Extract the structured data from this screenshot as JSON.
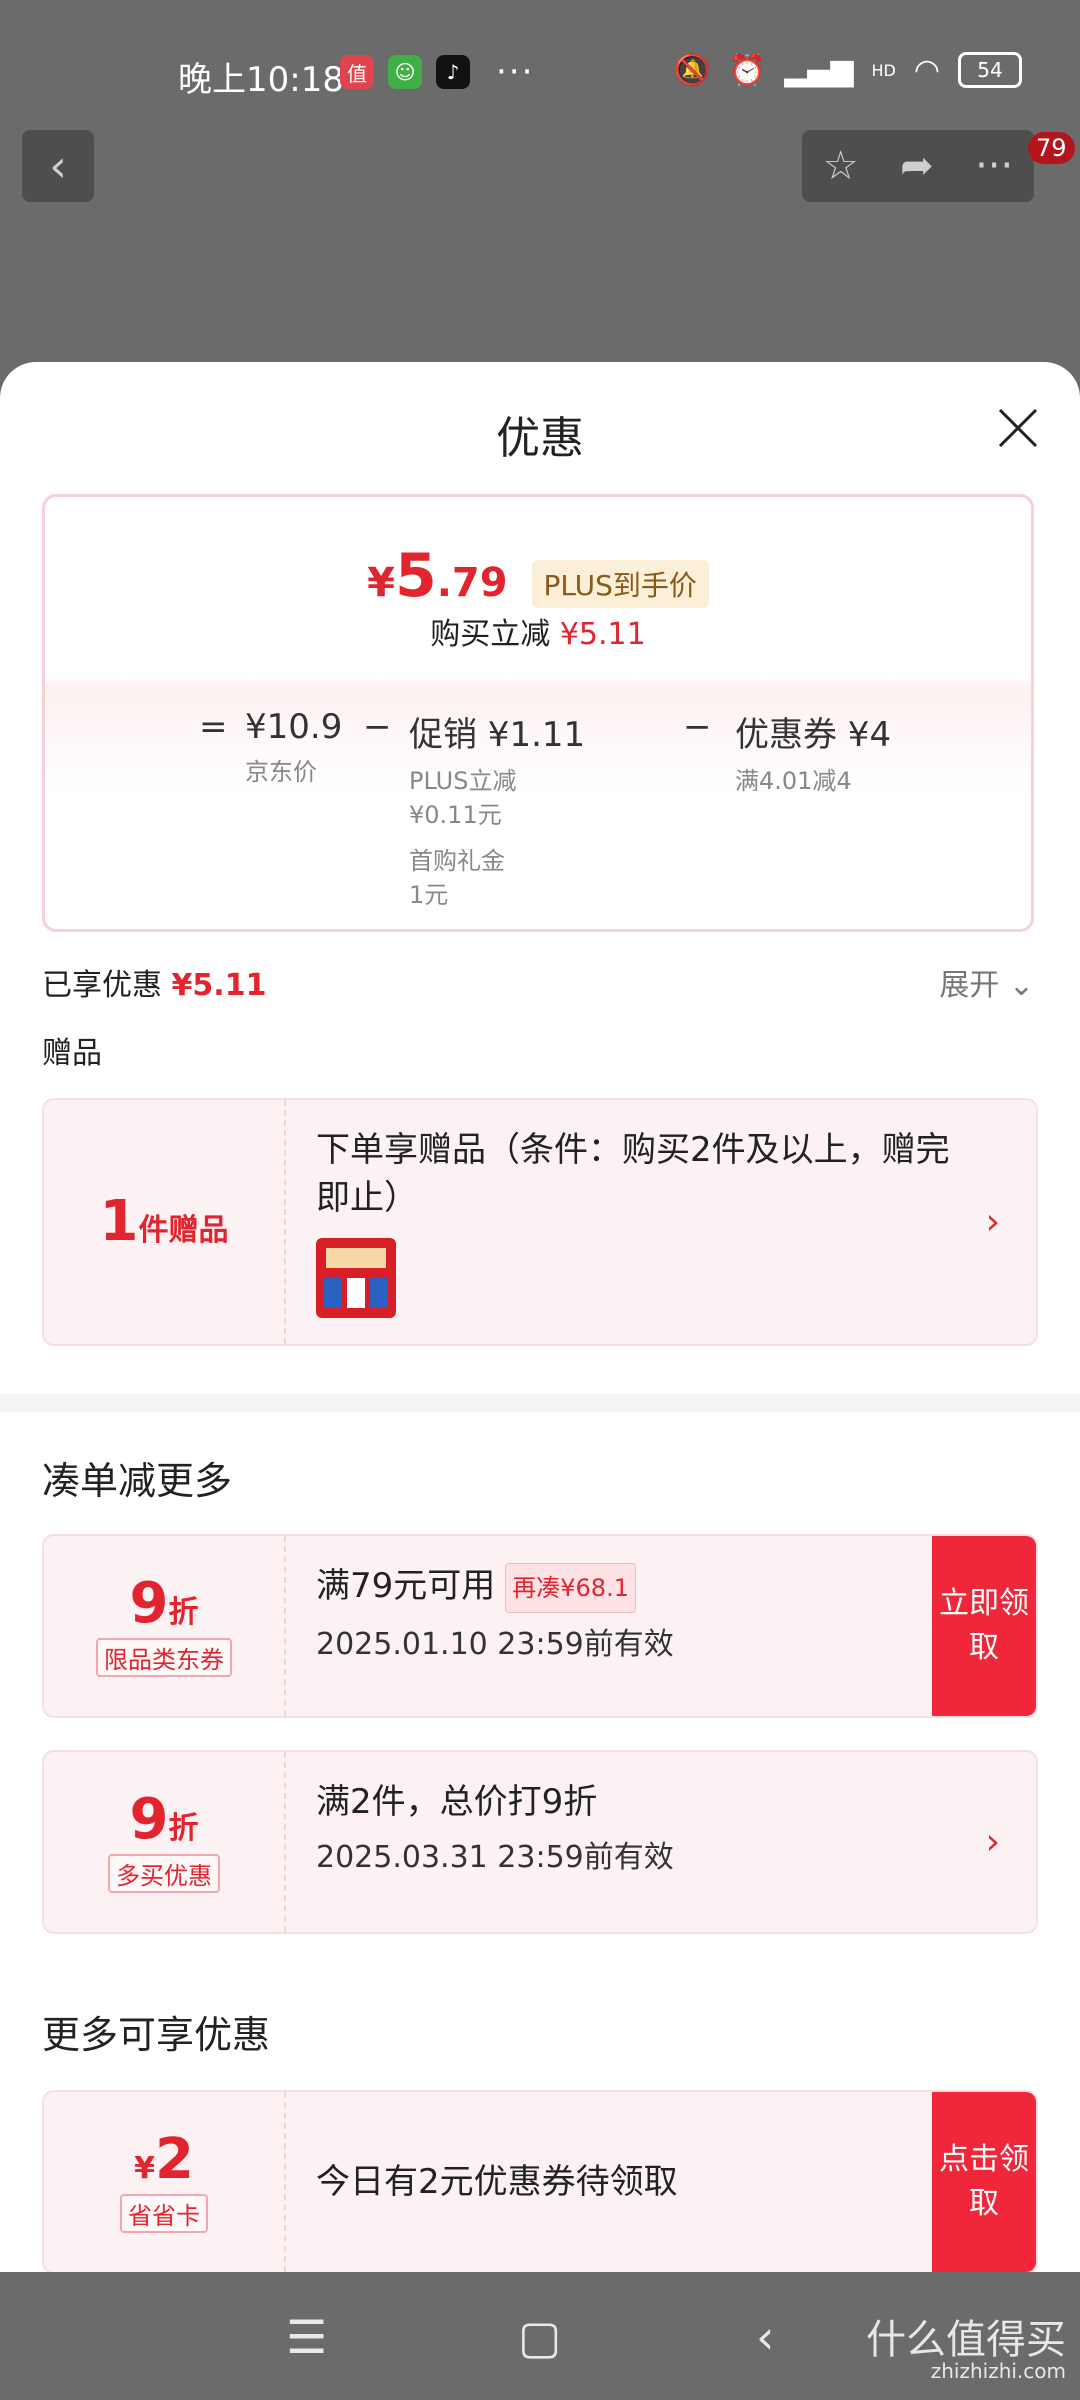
{
  "status": {
    "time": "晚上10:18",
    "apps": [
      {
        "glyph": "值",
        "color": "#e0454f"
      },
      {
        "glyph": "☺",
        "color": "#3fb045"
      },
      {
        "glyph": "♪",
        "color": "#111111"
      }
    ],
    "more": "···",
    "network": "HD",
    "battery": "54"
  },
  "topnav": {
    "badge": "79"
  },
  "sheet": {
    "title": "优惠",
    "price_card": {
      "currency": "¥",
      "price_int": "5",
      "price_dec": ".79",
      "plus_tag": "PLUS到手价",
      "reduce_label": "购买立减",
      "reduce_amount": "¥5.11",
      "eq": "=",
      "minus": "−",
      "jd_price": "¥10.9",
      "jd_price_label": "京东价",
      "promo": "促销 ¥1.11",
      "promo_sub1": "PLUS立减",
      "promo_sub1_val": "¥0.11元",
      "promo_sub2": "首购礼金",
      "promo_sub2_val": "1元",
      "coupon": "优惠券 ¥4",
      "coupon_sub": "满4.01减4"
    },
    "enjoyed_label": "已享优惠",
    "enjoyed_amount": "¥5.11",
    "expand_label": "展开",
    "gift_section": "赠品",
    "gift": {
      "count": "1",
      "unit": "件赠品",
      "text": "下单享赠品（条件：购买2件及以上，赠完即止）"
    },
    "combine_section": "凑单减更多",
    "coupons": [
      {
        "num": "9",
        "unit": "折",
        "tag": "限品类东券",
        "line1": "满79元可用",
        "extra": "再凑¥68.1",
        "line2": "2025.01.10 23:59前有效",
        "claim": "立即领取"
      },
      {
        "num": "9",
        "unit": "折",
        "tag": "多买优惠",
        "line1": "满2件，总价打9折",
        "line2": "2025.03.31 23:59前有效"
      }
    ],
    "more_section": "更多可享优惠",
    "more_coupon": {
      "currency": "¥",
      "num": "2",
      "tag": "省省卡",
      "line1": "今日有2元优惠券待领取",
      "claim": "点击领取"
    }
  },
  "watermark": {
    "main": "什么值得买",
    "sub": "zhizhizhi.com"
  },
  "colors": {
    "accent": "#e1242e",
    "claim_bg": "#f0263a",
    "plus_tag_bg": "#fbefd8"
  }
}
